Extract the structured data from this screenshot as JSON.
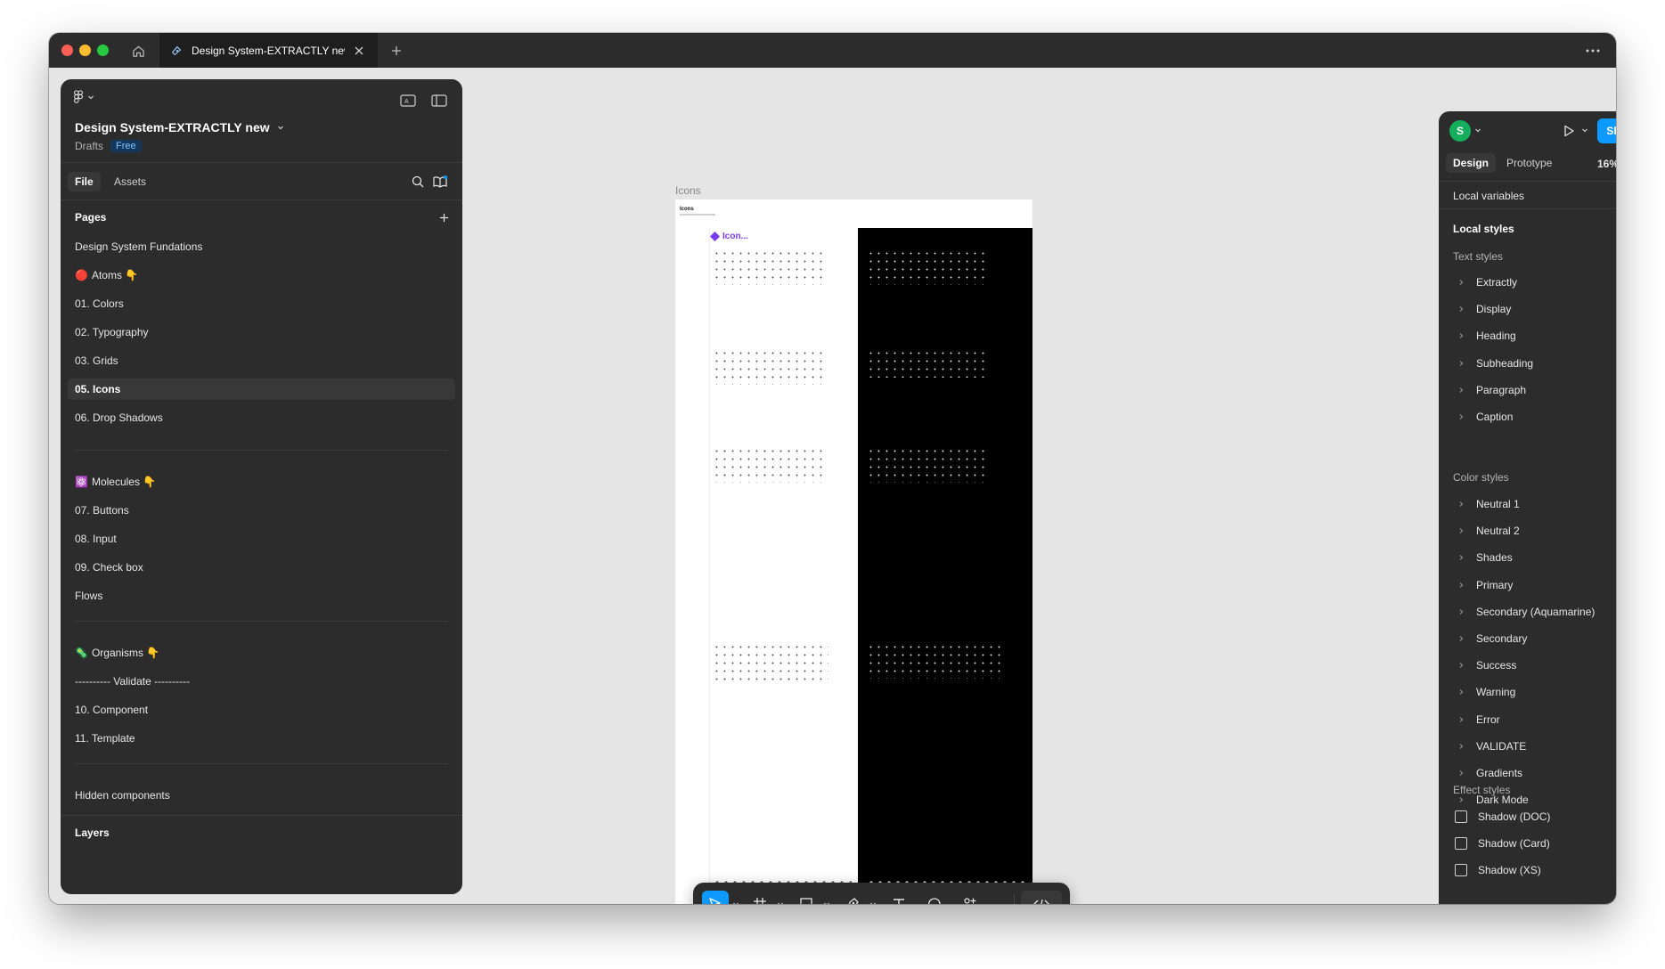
{
  "tab": {
    "title": "Design System-EXTRACTLY new"
  },
  "left_panel": {
    "file_title": "Design System-EXTRACTLY new",
    "location": "Drafts",
    "plan_badge": "Free",
    "tabs": {
      "file": "File",
      "assets": "Assets"
    },
    "pages_heading": "Pages",
    "pages": [
      {
        "label": "Design System Fundations"
      },
      {
        "emoji": "🔴",
        "label": "Atoms 👇"
      },
      {
        "label": "01.  Colors"
      },
      {
        "label": "02.  Typography"
      },
      {
        "label": "03.  Grids"
      },
      {
        "label": "05.  Icons"
      },
      {
        "label": "06.  Drop Shadows"
      },
      {
        "emoji": "⚛️",
        "label": "Molecules 👇"
      },
      {
        "label": "07. Buttons"
      },
      {
        "label": "08. Input"
      },
      {
        "label": "09. Check box"
      },
      {
        "label": "Flows"
      },
      {
        "emoji": "🦠",
        "label": "Organisms 👇"
      },
      {
        "label": "---------- Validate ----------"
      },
      {
        "label": "10. Component"
      },
      {
        "label": "11. Template"
      },
      {
        "label": "Hidden components"
      }
    ],
    "selected_page": "05.  Icons",
    "layers_heading": "Layers"
  },
  "canvas": {
    "frame_label": "Icons",
    "frame_heading": "Icons",
    "logo_text": "Icon..."
  },
  "right_panel": {
    "avatar_initial": "S",
    "share_label": "Share",
    "tabs": {
      "design": "Design",
      "prototype": "Prototype"
    },
    "zoom": "16%",
    "local_variables": "Local variables",
    "local_styles": "Local styles",
    "text_styles_heading": "Text styles",
    "text_styles": [
      "Extractly",
      "Display",
      "Heading",
      "Subheading",
      "Paragraph",
      "Caption"
    ],
    "color_styles_heading": "Color styles",
    "color_styles": [
      "Neutral 1",
      "Neutral 2",
      "Shades",
      "Primary",
      "Secondary (Aquamarine)",
      "Secondary",
      "Success",
      "Warning",
      "Error",
      "VALIDATE",
      "Gradients",
      "Dark Mode"
    ],
    "effect_styles_heading": "Effect styles",
    "effect_styles": [
      "Shadow (DOC)",
      "Shadow (Card)",
      "Shadow (XS)"
    ],
    "help_label": "?"
  },
  "colors": {
    "accent": "#0d99ff",
    "panel_bg": "#2c2c2c",
    "canvas_bg": "#e5e5e5",
    "avatar": "#14ae5c"
  }
}
